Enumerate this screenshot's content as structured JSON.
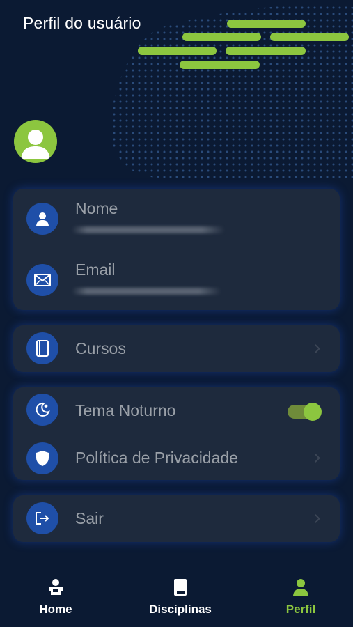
{
  "header": {
    "title": "Perfil do usuário"
  },
  "colors": {
    "background": "#0b1a33",
    "accent": "#8cc63f",
    "card": "#1e2a3d",
    "icon_bg": "#1f4fa8"
  },
  "avatar": {
    "icon": "person-icon"
  },
  "info_card": {
    "name_label": "Nome",
    "email_label": "Email"
  },
  "menu": {
    "cursos_label": "Cursos",
    "tema_label": "Tema Noturno",
    "tema_enabled": true,
    "privacidade_label": "Política de Privacidade",
    "sair_label": "Sair"
  },
  "nav": {
    "items": [
      {
        "label": "Home",
        "icon": "home-icon",
        "active": false
      },
      {
        "label": "Disciplinas",
        "icon": "book-icon",
        "active": false
      },
      {
        "label": "Perfil",
        "icon": "person-icon",
        "active": true
      }
    ]
  }
}
